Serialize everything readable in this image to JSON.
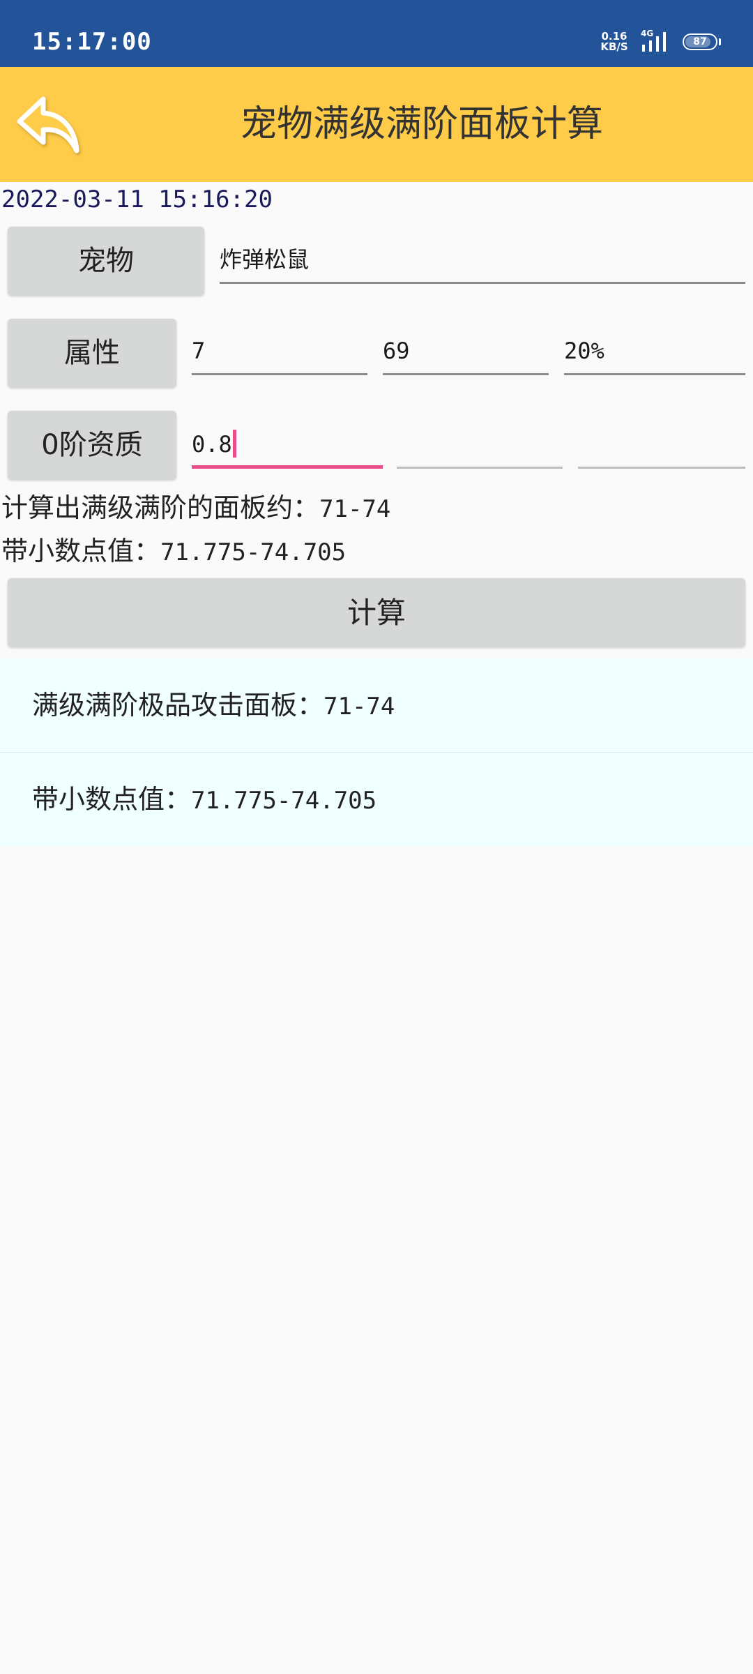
{
  "status_bar": {
    "time": "15:17:00",
    "net_speed_value": "0.16",
    "net_speed_unit": "KB/S",
    "network_type": "4G",
    "battery": "87"
  },
  "app_bar": {
    "title": "宠物满级满阶面板计算",
    "back_icon": "back-arrow-icon"
  },
  "datetime": "2022-03-11 15:16:20",
  "pet": {
    "label": "宠物",
    "value": "炸弹松鼠"
  },
  "attribute": {
    "label": "属性",
    "values": [
      "7",
      "69",
      "20%"
    ]
  },
  "aptitude": {
    "label": "0阶资质",
    "values": [
      "0.8",
      "",
      ""
    ]
  },
  "summary": {
    "approx_label": "计算出满级满阶的面板约：",
    "approx_value": "71-74",
    "decimal_label": "带小数点值：",
    "decimal_value": "71.775-74.705"
  },
  "calculate_button": "计算",
  "results": [
    {
      "label": "满级满阶极品攻击面板：",
      "value": "71-74"
    },
    {
      "label": "带小数点值：",
      "value": "71.775-74.705"
    }
  ],
  "colors": {
    "status_bar": "#235398",
    "app_bar": "#ffcc4a",
    "focus_accent": "#ea4c89",
    "list_background": "#f0ffff"
  }
}
